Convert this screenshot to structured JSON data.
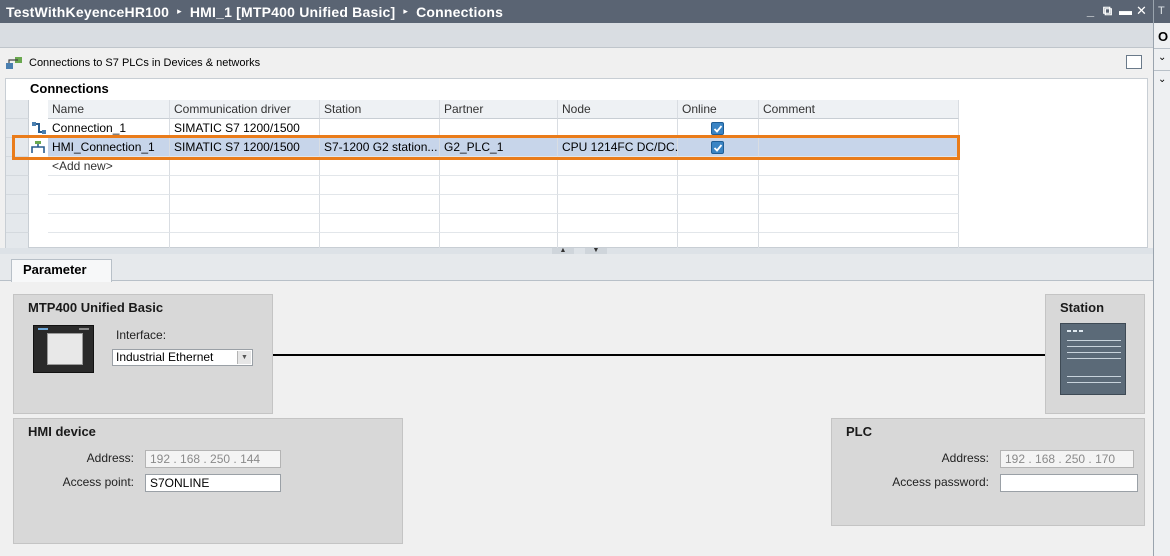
{
  "title_bar": {
    "breadcrumbs": [
      "TestWithKeyenceHR100",
      "HMI_1 [MTP400 Unified Basic]",
      "Connections"
    ],
    "controls": [
      "minimize-icon",
      "restore-icon",
      "float-icon",
      "close-icon"
    ],
    "control_glyphs": {
      "minimize": "_",
      "restore": "⧉",
      "float": "▬",
      "close": "✕"
    },
    "separator": "▸"
  },
  "right_panel": {
    "header": "T",
    "letter": "O",
    "chevron": "⌄"
  },
  "header": {
    "text": "Connections to S7 PLCs in Devices & networks"
  },
  "connections": {
    "title": "Connections",
    "columns": [
      "Name",
      "Communication driver",
      "Station",
      "Partner",
      "Node",
      "Online",
      "Comment"
    ],
    "rows": [
      {
        "name": "Connection_1",
        "driver": "SIMATIC S7 1200/1500",
        "station": "",
        "partner": "",
        "node": "",
        "online": true,
        "comment": ""
      },
      {
        "name": "HMI_Connection_1",
        "driver": "SIMATIC S7 1200/1500",
        "station": "S7-1200 G2 station...",
        "partner": "G2_PLC_1",
        "node": "CPU 1214FC DC/DC...",
        "online": true,
        "comment": ""
      }
    ],
    "add_new": "<Add new>",
    "selected_row": 1
  },
  "parameter": {
    "tab": "Parameter",
    "hmi_panel": {
      "title": "MTP400 Unified Basic",
      "interface_label": "Interface:",
      "interface_value": "Industrial Ethernet"
    },
    "station_panel": {
      "title": "Station"
    },
    "hmi_device": {
      "title": "HMI device",
      "address_label": "Address:",
      "address": "192 . 168 . 250 . 144",
      "access_point_label": "Access point:",
      "access_point": "S7ONLINE"
    },
    "plc": {
      "title": "PLC",
      "address_label": "Address:",
      "address": "192 . 168 . 250 . 170",
      "password_label": "Access password:",
      "password": ""
    }
  },
  "colors": {
    "title_bar": "#5a6473",
    "selection": "#c7d5ea",
    "highlight_box": "#ea7c1a",
    "checkbox": "#3a84c4"
  }
}
